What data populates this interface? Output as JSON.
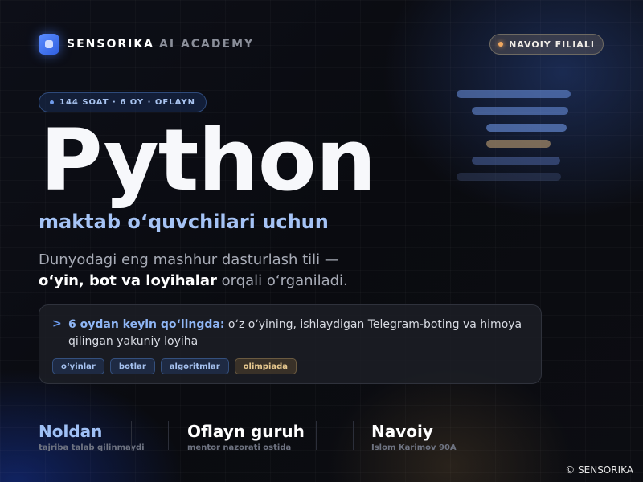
{
  "colors": {
    "accent_blue": "#6c9cf0",
    "subtitle_blue": "#a5c3f5",
    "warm_accent": "#f0a860",
    "background": "#0b0c12"
  },
  "header": {
    "logo_icon": "square-app-icon",
    "brand_name": "SENSORIKA",
    "brand_suffix": "AI ACADEMY",
    "branch": "NAVOIY FILIALI"
  },
  "course": {
    "info": "144 SOAT · 6 OY · OFLAYN",
    "title": "Python",
    "subtitle": "maktab o‘quvchilari uchun",
    "desc_line1": "Dunyodagi eng mashhur dasturlash tili —",
    "desc_bold": "o‘yin, bot va loyihalar",
    "desc_rest": " orqali o‘rganiladi."
  },
  "card": {
    "prompt": ">",
    "highlight": "6 oydan keyin qo‘lingda:",
    "text": " o‘z o‘yining, ishlaydigan Telegram-boting va himoya qilingan yakuniy loyiha",
    "tags": [
      "o‘yinlar",
      "botlar",
      "algoritmlar",
      "olimpiada"
    ]
  },
  "stats": [
    {
      "value": "Noldan",
      "label": "tajriba talab qilinmaydi"
    },
    {
      "value": "Oflayn guruh",
      "label": "mentor nazorati ostida"
    },
    {
      "value": "Navoiy",
      "label": "Islom Karimov 90A"
    }
  ],
  "footer": {
    "copyright": "© SENSORIKA"
  }
}
